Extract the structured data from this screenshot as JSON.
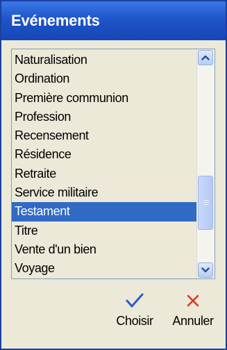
{
  "window": {
    "title": "Evénements"
  },
  "list": {
    "items": [
      {
        "label": "Naturalisation",
        "selected": false
      },
      {
        "label": "Ordination",
        "selected": false
      },
      {
        "label": "Première communion",
        "selected": false
      },
      {
        "label": "Profession",
        "selected": false
      },
      {
        "label": "Recensement",
        "selected": false
      },
      {
        "label": "Résidence",
        "selected": false
      },
      {
        "label": "Retraite",
        "selected": false
      },
      {
        "label": "Service militaire",
        "selected": false
      },
      {
        "label": "Testament",
        "selected": true
      },
      {
        "label": "Titre",
        "selected": false
      },
      {
        "label": "Vente d'un bien",
        "selected": false
      },
      {
        "label": "Voyage",
        "selected": false
      }
    ]
  },
  "scrollbar": {
    "up_icon": "chevron-up-icon",
    "down_icon": "chevron-down-icon"
  },
  "actions": {
    "choose_label": "Choisir",
    "choose_icon": "checkmark-icon",
    "cancel_label": "Annuler",
    "cancel_icon": "close-x-icon"
  },
  "colors": {
    "title_bar": "#1e55c9",
    "selection": "#316ac5",
    "background": "#ece9d8",
    "check": "#2b5ad6",
    "cancel_x": "#e0342c"
  }
}
